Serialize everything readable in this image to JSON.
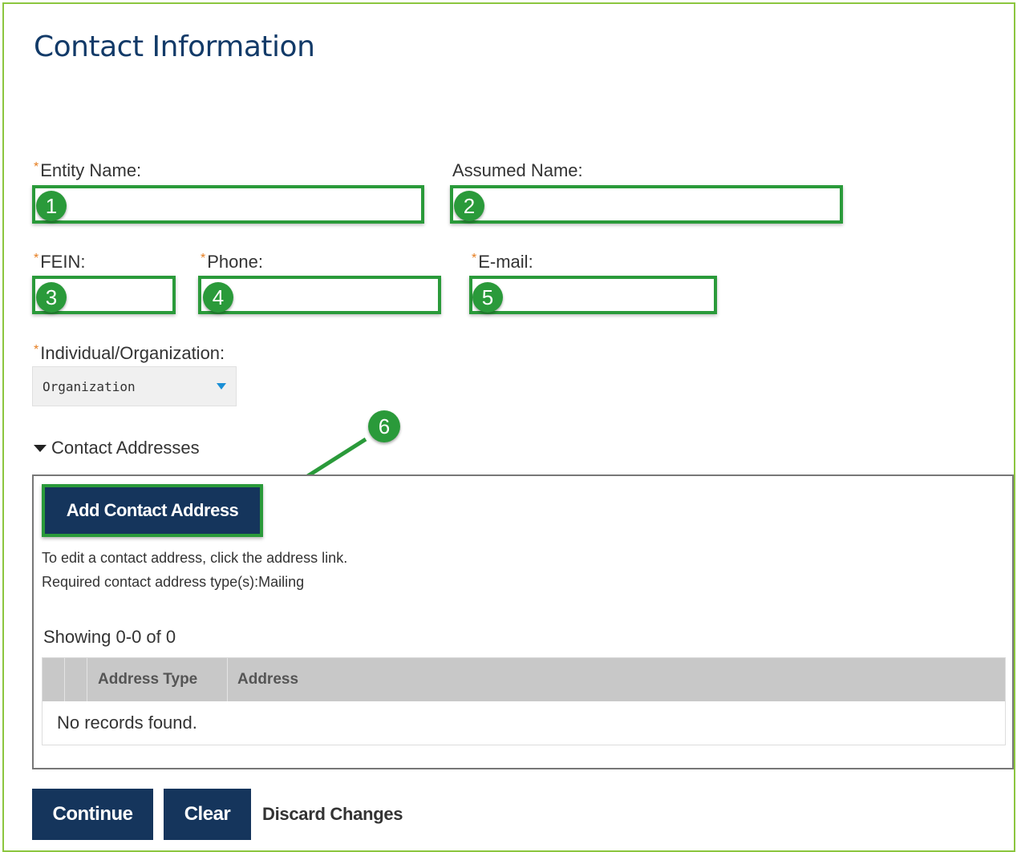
{
  "page": {
    "title": "Contact Information"
  },
  "fields": {
    "entity_name": {
      "label": "Entity Name:",
      "value": "",
      "callout": "1"
    },
    "assumed_name": {
      "label": "Assumed Name:",
      "value": "",
      "callout": "2"
    },
    "fein": {
      "label": "FEIN:",
      "value": "",
      "callout": "3"
    },
    "phone": {
      "label": "Phone:",
      "value": "",
      "callout": "4"
    },
    "email": {
      "label": "E-mail:",
      "value": "",
      "callout": "5"
    },
    "individual_org": {
      "label": "Individual/Organization:",
      "selected": "Organization"
    }
  },
  "required_marker": "*",
  "contact_addresses": {
    "section_label": "Contact Addresses",
    "add_button": "Add Contact Address",
    "callout": "6",
    "note_edit": "To edit a contact address, click the address link.",
    "note_required": "Required contact address type(s):Mailing",
    "showing": "Showing 0-0 of 0",
    "columns": [
      "Address Type",
      "Address"
    ],
    "empty_message": "No records found."
  },
  "actions": {
    "continue": "Continue",
    "clear": "Clear",
    "discard": "Discard Changes"
  },
  "colors": {
    "callout_green": "#2a9a3a",
    "navy": "#15355c",
    "title_blue": "#123a68",
    "required_orange": "#e57c1e"
  }
}
